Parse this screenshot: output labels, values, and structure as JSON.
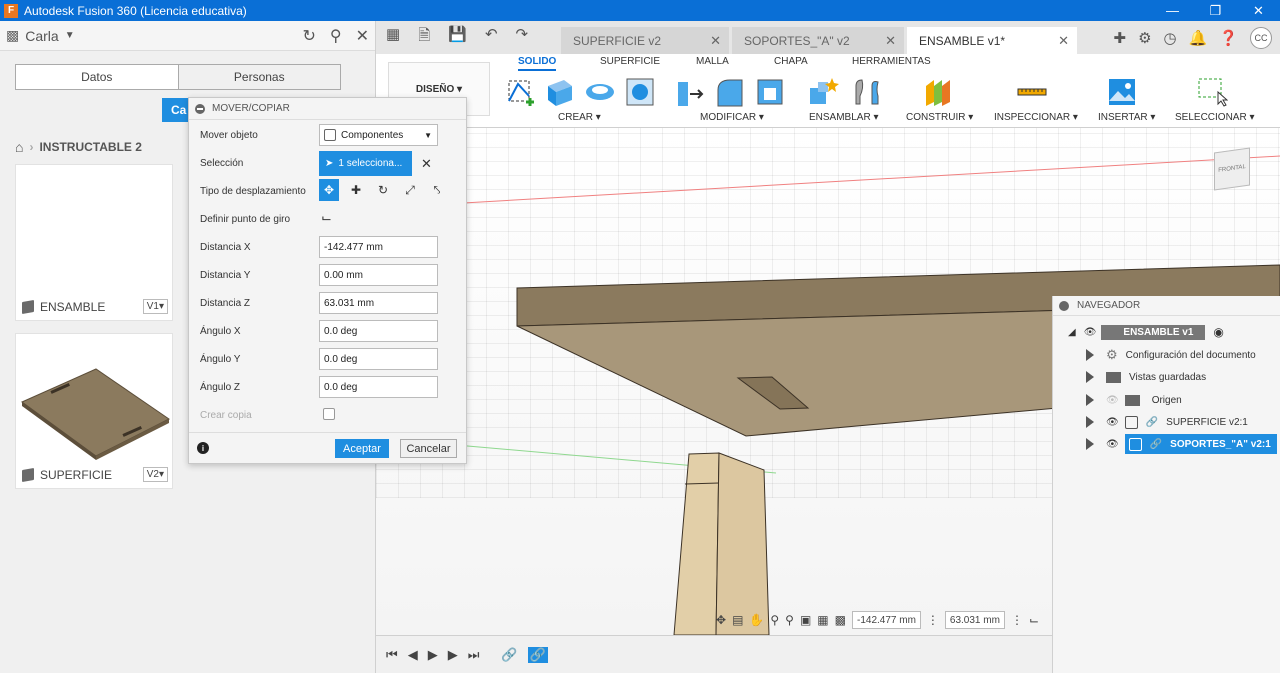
{
  "window": {
    "title": "Autodesk Fusion 360 (Licencia educativa)",
    "app_letter": "F"
  },
  "left_panel": {
    "user": "Carla",
    "tabs": [
      "Datos",
      "Personas"
    ],
    "blue_tab_label": "Ca",
    "breadcrumb": "INSTRUCTABLE 2",
    "cards": [
      {
        "name": "ENSAMBLE",
        "version": "V1▾"
      },
      {
        "name": "SUPERFICIE",
        "version": "V2▾"
      }
    ]
  },
  "doc_tabs": [
    {
      "label": "SUPERFICIE v2",
      "active": false
    },
    {
      "label": "SOPORTES_\"A\" v2",
      "active": false
    },
    {
      "label": "ENSAMBLE v1*",
      "active": true
    }
  ],
  "user_initials": "CC",
  "toolbar": {
    "workspace": "DISEÑO ▾",
    "tabs": [
      "SOLIDO",
      "SUPERFICIE",
      "MALLA",
      "CHAPA",
      "HERRAMIENTAS"
    ],
    "groups": [
      "CREAR ▾",
      "MODIFICAR ▾",
      "ENSAMBLAR ▾",
      "CONSTRUIR ▾",
      "INSPECCIONAR ▾",
      "INSERTAR ▾",
      "SELECCIONAR ▾"
    ]
  },
  "dialog": {
    "title": "MOVER/COPIAR",
    "labels": {
      "mover_objeto": "Mover objeto",
      "seleccion": "Selección",
      "tipo": "Tipo de desplazamiento",
      "punto_giro": "Definir punto de giro",
      "dist_x": "Distancia X",
      "dist_y": "Distancia Y",
      "dist_z": "Distancia Z",
      "ang_x": "Ángulo X",
      "ang_y": "Ángulo Y",
      "ang_z": "Ángulo Z",
      "copia": "Crear copia"
    },
    "values": {
      "mover_objeto": "Componentes",
      "seleccion": "1 selecciona...",
      "dist_x": "-142.477 mm",
      "dist_y": "0.00 mm",
      "dist_z": "63.031 mm",
      "ang_x": "0.0 deg",
      "ang_y": "0.0 deg",
      "ang_z": "0.0 deg"
    },
    "ok": "Aceptar",
    "cancel": "Cancelar"
  },
  "navigator": {
    "title": "NAVEGADOR",
    "root": "ENSAMBLE v1",
    "items": [
      "Configuración del documento",
      "Vistas guardadas",
      "Origen",
      "SUPERFICIE v2:1",
      "SOPORTES_\"A\" v2:1"
    ]
  },
  "viewcube_label": "FRONTAL",
  "nav_bar": {
    "x": "-142.477 mm",
    "z": "63.031 mm"
  },
  "colors": {
    "accent": "#1f8ee0",
    "titlebar": "#0a6fd6",
    "wood": "#8b7a5e",
    "leg": "#e2cfa8"
  }
}
